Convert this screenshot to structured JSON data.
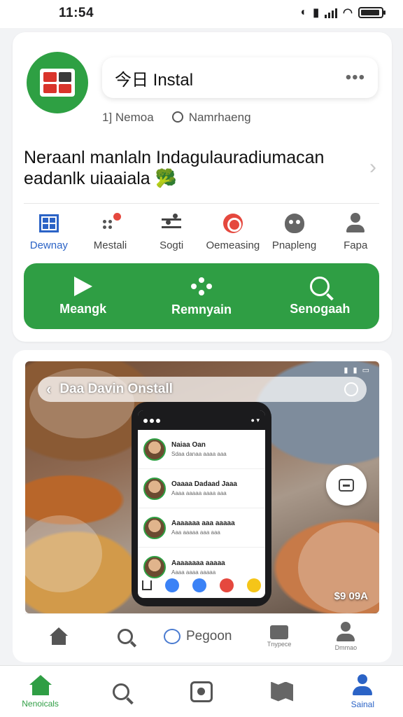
{
  "status_bar": {
    "time": "11:54"
  },
  "header": {
    "title": "今日 Instal",
    "more": "•••",
    "meta_left": "1] Nemoa",
    "meta_right": "Namrhaeng"
  },
  "headline": {
    "line1": "Neraanl manlaln Indagulauradiumacan",
    "line2": "eadanlk uiaaiala",
    "emoji": "🥦"
  },
  "categories": [
    {
      "label": "Dewnay"
    },
    {
      "label": "Mestali"
    },
    {
      "label": "Sogti"
    },
    {
      "label": "Oemeasing"
    },
    {
      "label": "Pnapleng"
    },
    {
      "label": "Fapa"
    }
  ],
  "actions": [
    {
      "label": "Meangk"
    },
    {
      "label": "Remnyain"
    },
    {
      "label": "Senogaah"
    }
  ],
  "media": {
    "title": "Daa Davin Onstall",
    "price": "$9 09A",
    "chats": [
      {
        "name": "Naiaa Oan",
        "sub": "Sdaa danaa aaaa aaa"
      },
      {
        "name": "Oaaaa Dadaad Jaaa",
        "sub": "Aaaa aaaaa aaaa aaa"
      },
      {
        "name": "Aaaaaaa aaa aaaaa",
        "sub": "Aaa aaaaa aaa aaa"
      },
      {
        "name": "Aaaaaaaa aaaaa",
        "sub": "Aaaa aaaa aaaaa"
      }
    ]
  },
  "media_actions": {
    "comment_label": "Pegoon",
    "tray_label": "Tnypece",
    "person_label": "Dmmao"
  },
  "tab_bar": [
    {
      "label": "Nenoicals"
    },
    {
      "label": ""
    },
    {
      "label": ""
    },
    {
      "label": ""
    },
    {
      "label": "Sainal"
    }
  ],
  "colors": {
    "brand_green": "#2f9e44",
    "accent_blue": "#2b63c6",
    "alert_red": "#e5483e"
  }
}
